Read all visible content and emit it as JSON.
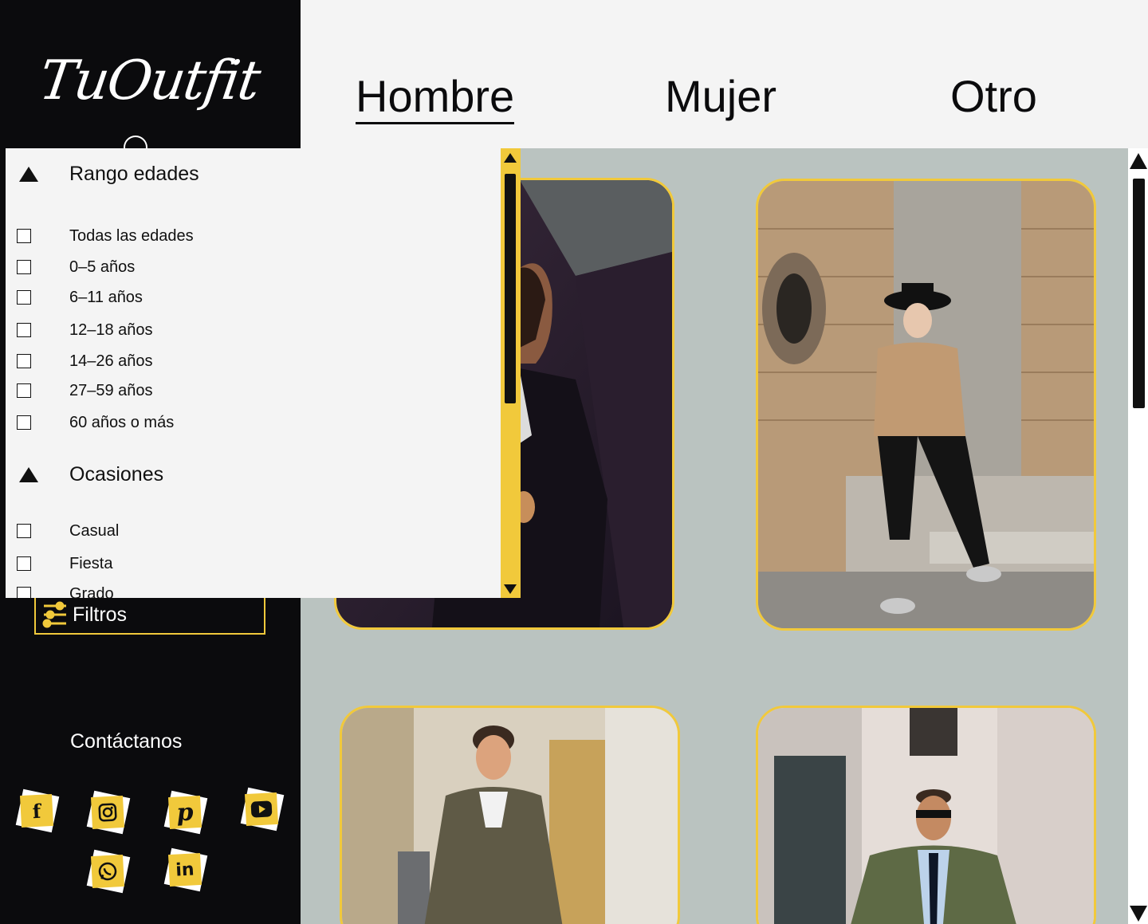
{
  "brand": {
    "logo": "TuOutfit"
  },
  "nav": {
    "tabs": [
      {
        "label": "Hombre",
        "active": true
      },
      {
        "label": "Mujer",
        "active": false
      },
      {
        "label": "Otro",
        "active": false
      }
    ]
  },
  "sidebar": {
    "filter_button": "Filtros",
    "contact_title": "Contáctanos",
    "social": [
      "facebook-icon",
      "instagram-icon",
      "pinterest-icon",
      "youtube-icon",
      "whatsapp-icon",
      "linkedin-icon"
    ]
  },
  "filters": {
    "sections": [
      {
        "title": "Rango edades",
        "options": [
          "Todas las edades",
          "0–5 años",
          "6–11 años",
          "12–18 años",
          "14–26 años",
          "27–59 años",
          "60 años o más"
        ]
      },
      {
        "title": "Ocasiones",
        "options": [
          "Casual",
          "Fiesta",
          "Grado"
        ]
      }
    ]
  },
  "colors": {
    "accent": "#f1c93b",
    "sidebar": "#0b0b0d",
    "content_bg": "#bac3c0",
    "panel_bg": "#f4f4f4"
  },
  "products": [
    {
      "image": "man-in-dark-suit-photo"
    },
    {
      "image": "man-in-hat-sitting-on-steps-photo"
    },
    {
      "image": "man-in-olive-jacket-street-photo"
    },
    {
      "image": "man-in-sunglasses-green-jacket-photo"
    }
  ]
}
